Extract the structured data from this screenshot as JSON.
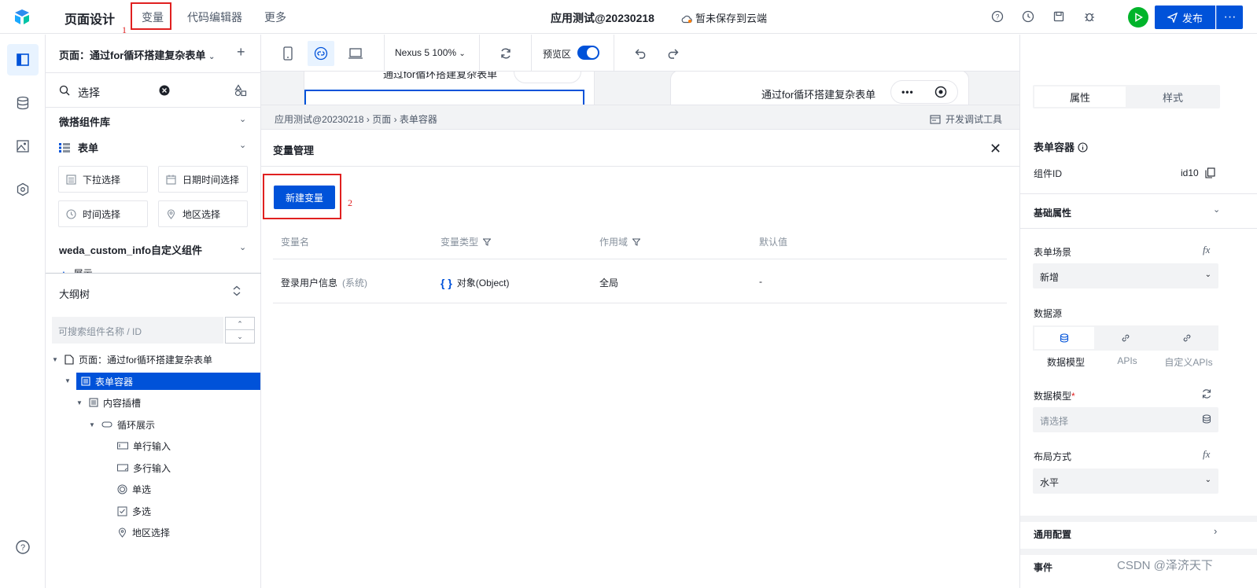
{
  "topbar": {
    "title": "页面设计",
    "tabs": [
      "变量",
      "代码编辑器",
      "更多"
    ],
    "annotation_1": "1",
    "app_name": "应用测试@20230218",
    "save_status": "暂未保存到云端",
    "publish_label": "发布",
    "more_label": "···"
  },
  "left_panel": {
    "page_select": "页面：通过for循环搭建复杂表单",
    "search_text": "选择",
    "library_title": "微搭组件库",
    "form_group": "表单",
    "components": [
      "下拉选择",
      "日期时间选择",
      "时间选择",
      "地区选择"
    ],
    "custom_group": "weda_custom_info自定义组件",
    "peek_item": "展示",
    "outline_title": "大纲树",
    "outline_search_placeholder": "可搜索组件名称 / ID",
    "tree": [
      {
        "label": "页面：通过for循环搭建复杂表单",
        "icon": "page-icon"
      },
      {
        "label": "表单容器",
        "icon": "form-icon"
      },
      {
        "label": "内容插槽",
        "icon": "slot-icon"
      },
      {
        "label": "循环展示",
        "icon": "loop-icon"
      },
      {
        "label": "单行输入",
        "icon": "input-icon"
      },
      {
        "label": "多行输入",
        "icon": "textarea-icon"
      },
      {
        "label": "单选",
        "icon": "radio-icon"
      },
      {
        "label": "多选",
        "icon": "checkbox-icon"
      },
      {
        "label": "地区选择",
        "icon": "location-icon"
      }
    ]
  },
  "toolbar": {
    "device": "Nexus 5 100%",
    "preview_label": "预览区",
    "preview_on": true
  },
  "canvas": {
    "page_title": "通过for循环搭建复杂表单"
  },
  "breadcrumb": {
    "path": "应用测试@20230218  ›  页面  ›  表单容器",
    "dev_tools": "开发调试工具"
  },
  "variables": {
    "title": "变量管理",
    "new_button": "新建变量",
    "annotation_2": "2",
    "columns": [
      "变量名",
      "变量类型",
      "作用域",
      "默认值"
    ],
    "rows": [
      {
        "name": "登录用户信息",
        "tag": "(系统)",
        "type": "对象(Object)",
        "scope": "全局",
        "default": "-"
      }
    ]
  },
  "right_panel": {
    "tabs": [
      "属性",
      "样式"
    ],
    "component_title": "表单容器",
    "component_id_label": "组件ID",
    "component_id": "id10",
    "basic_props": "基础属性",
    "form_scene_label": "表单场景",
    "form_scene_value": "新增",
    "datasource_label": "数据源",
    "datasource_tabs": [
      "数据模型",
      "APIs",
      "自定义APIs"
    ],
    "data_model_label": "数据模型",
    "data_model_placeholder": "请选择",
    "layout_label": "布局方式",
    "layout_value": "水平",
    "general_config": "通用配置",
    "events": "事件",
    "fx": "fx"
  },
  "watermark": "CSDN @泽济天下",
  "colors": {
    "primary": "#0052d9",
    "run": "#00b42a",
    "annotation": "#e02020"
  }
}
